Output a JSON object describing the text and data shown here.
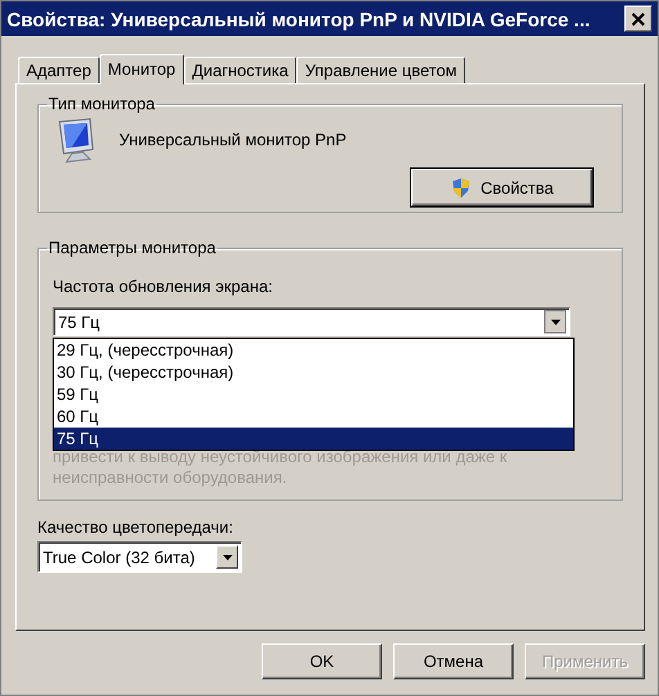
{
  "window": {
    "title": "Свойства: Универсальный монитор PnP и NVIDIA GeForce ..."
  },
  "tabs": [
    {
      "label": "Адаптер",
      "selected": false
    },
    {
      "label": "Монитор",
      "selected": true
    },
    {
      "label": "Диагностика",
      "selected": false
    },
    {
      "label": "Управление цветом",
      "selected": false
    }
  ],
  "monitor_type": {
    "title": "Тип монитора",
    "name": "Универсальный монитор PnP",
    "properties_button": "Свойства"
  },
  "monitor_settings": {
    "title": "Параметры монитора",
    "refresh_rate": {
      "label": "Частота обновления экрана:",
      "value": "75 Гц",
      "expanded": true,
      "options": [
        {
          "label": "29 Гц, (чересстрочная)",
          "selected": false
        },
        {
          "label": "30 Гц, (чересстрочная)",
          "selected": false
        },
        {
          "label": "59 Гц",
          "selected": false
        },
        {
          "label": "60 Гц",
          "selected": false
        },
        {
          "label": "75 Гц",
          "selected": true
        }
      ]
    },
    "hint": "привести к выводу неустойчивого изображения или даже к неисправности оборудования."
  },
  "color_quality": {
    "label": "Качество цветопередачи:",
    "value": "True Color (32 бита)"
  },
  "buttons": [
    {
      "label": "OK",
      "disabled": false
    },
    {
      "label": "Отмена",
      "disabled": false
    },
    {
      "label": "Применить",
      "disabled": true
    }
  ]
}
